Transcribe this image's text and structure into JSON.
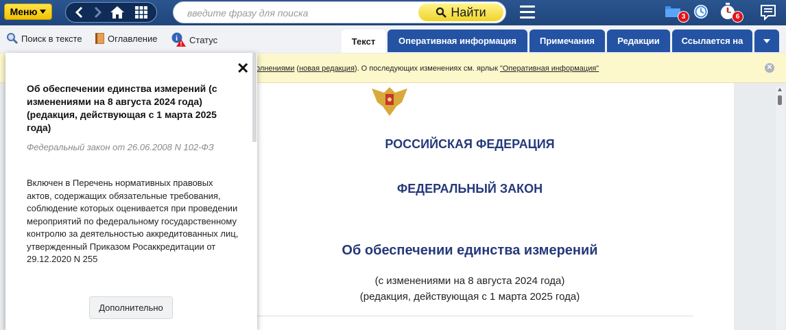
{
  "topbar": {
    "menu_label": "Меню",
    "search_placeholder": "введите фразу для поиска",
    "find_label": "Найти",
    "folder_badge": "3",
    "timer_badge": "6"
  },
  "toolbar": {
    "search_in_text": "Поиск в тексте",
    "contents": "Оглавление",
    "status": "Статус"
  },
  "tabs": [
    {
      "label": "Текст"
    },
    {
      "label": "Оперативная информация"
    },
    {
      "label": "Примечания"
    },
    {
      "label": "Редакции"
    },
    {
      "label": "Ссылается на"
    }
  ],
  "notice": {
    "part1": "олнениями",
    "sep1": " (",
    "link_new": "новая редакция",
    "part2": "). О последующих изменениях см. ярлык ",
    "link_oper": "\"Оперативная информация\""
  },
  "document": {
    "country": "РОССИЙСКАЯ ФЕДЕРАЦИЯ",
    "law_type": "ФЕДЕРАЛЬНЫЙ ЗАКОН",
    "title": "Об обеспечении единства измерений",
    "changes_line1": "(с изменениями на 8 августа 2024 года)",
    "changes_line2": "(редакция, действующая с 1 марта 2025 года)"
  },
  "status_panel": {
    "title": "Об обеспечении единства измерений (с изменениями на 8 августа 2024 года) (редакция, действующая с 1 марта 2025 года)",
    "subtitle": "Федеральный закон от 26.06.2008 N 102-ФЗ",
    "body": "Включен в Перечень нормативных правовых актов, содержащих обязательные требования, соблюдение которых оценивается при проведении мероприятий по федеральному государственному контролю за деятельностью аккредитованных лиц, утвержденный Приказом Росаккредитации от 29.12.2020 N 255",
    "more_label": "Дополнительно"
  },
  "colors": {
    "topbar": "#1f467c",
    "tab_blue": "#2453a4",
    "menu_yellow": "#f2c100",
    "notice_bg": "#fdf7cc",
    "doc_heading": "#25397a",
    "badge_red": "#e0141c"
  },
  "icons": [
    "chevron-left-icon",
    "chevron-right-icon",
    "home-icon",
    "grid-icon",
    "search-icon",
    "hamburger-icon",
    "folder-icon",
    "clock-icon",
    "stopwatch-icon",
    "chat-icon",
    "magnifier-icon",
    "book-icon",
    "info-warning-icon",
    "dropdown-arrow-icon",
    "close-icon",
    "coat-of-arms-icon"
  ]
}
